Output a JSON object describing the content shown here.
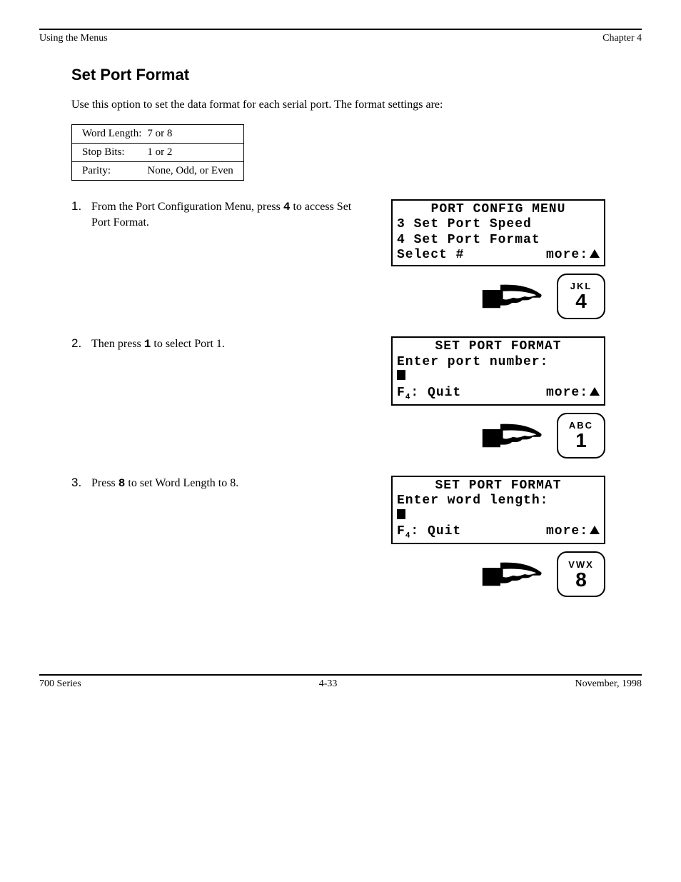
{
  "header": {
    "doc": "Using the Menus",
    "chapter": "Chapter 4"
  },
  "section_title": "Set Port Format",
  "intro": "Use this option to set the data format for each serial port.  The format settings are:",
  "table": {
    "rows": [
      [
        "Word Length:",
        "7 or 8"
      ],
      [
        "Stop Bits:",
        "1 or 2"
      ],
      [
        "Parity:",
        "None, Odd, or Even"
      ]
    ]
  },
  "steps": [
    {
      "num": "1.",
      "text_pre": "From the Port Configuration Menu, press ",
      "key": "4",
      "text_post": " to access Set Port Format.",
      "screen": {
        "title": "PORT CONFIG MENU",
        "lines": [
          "3 Set Port Speed",
          "4 Set Port Format"
        ],
        "bl_left": "Select #",
        "bl_right": "more:"
      },
      "keypad": {
        "letters": "JKL",
        "num": "4"
      }
    },
    {
      "num": "2.",
      "text_pre": "Then press ",
      "key": "1",
      "text_post": " to select Port 1.",
      "screen": {
        "title": "SET PORT FORMAT",
        "lines": [
          "Enter port number:"
        ],
        "cursor": true,
        "bl_left_f4quit": true,
        "bl_right": "more:"
      },
      "keypad": {
        "letters": "ABC",
        "num": "1"
      }
    },
    {
      "num": "3.",
      "text_pre": "Press ",
      "key": "8",
      "text_post": " to set Word Length to 8.",
      "screen": {
        "title": "SET PORT FORMAT",
        "lines": [
          "Enter word length:"
        ],
        "cursor": true,
        "bl_left_f4quit": true,
        "bl_right": "more:"
      },
      "keypad": {
        "letters": "VWX",
        "num": "8"
      }
    }
  ],
  "footer": {
    "left": "700 Series",
    "right": "November, 1998",
    "page": "4-33"
  }
}
